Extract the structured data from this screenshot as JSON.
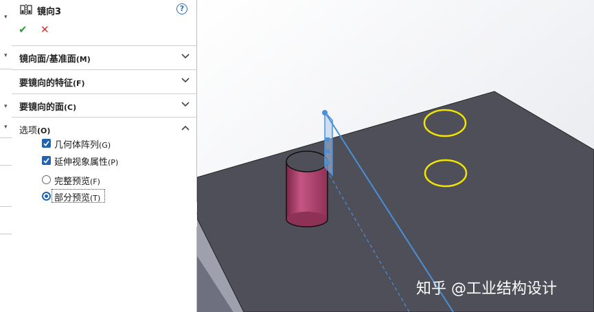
{
  "feature": {
    "title": "镜向3",
    "help_label": "?",
    "ok_icon": "check-icon",
    "cancel_icon": "x-icon"
  },
  "groups": [
    {
      "label": "镜向面/基准面",
      "key": "(M)",
      "state": "collapsed"
    },
    {
      "label": "要镜向的特征",
      "key": "(F)",
      "state": "collapsed"
    },
    {
      "label": "要镜向的面",
      "key": "(C)",
      "state": "collapsed"
    },
    {
      "label": "选项",
      "key": "(O)",
      "state": "expanded"
    }
  ],
  "options": {
    "geometry_pattern": {
      "label": "几何体阵列",
      "key": "(G)",
      "checked": true
    },
    "propagate_visual": {
      "label": "延伸视象属性",
      "key": "(P)",
      "checked": true
    },
    "full_preview": {
      "label": "完整预览",
      "key": "(F)",
      "selected": false
    },
    "partial_preview": {
      "label": "部分预览",
      "key": "(T)",
      "selected": true
    }
  },
  "watermark": "知乎 @工业结构设计",
  "colors": {
    "accent": "#1e64b4",
    "ok": "#2e9a3a",
    "cancel": "#d0302a",
    "model_top": "#4e4f59",
    "model_side": "#8a8c99",
    "cylinder": "#b5456f",
    "hole_outline": "#f2e600",
    "mirror_plane": "#4a90d9"
  }
}
